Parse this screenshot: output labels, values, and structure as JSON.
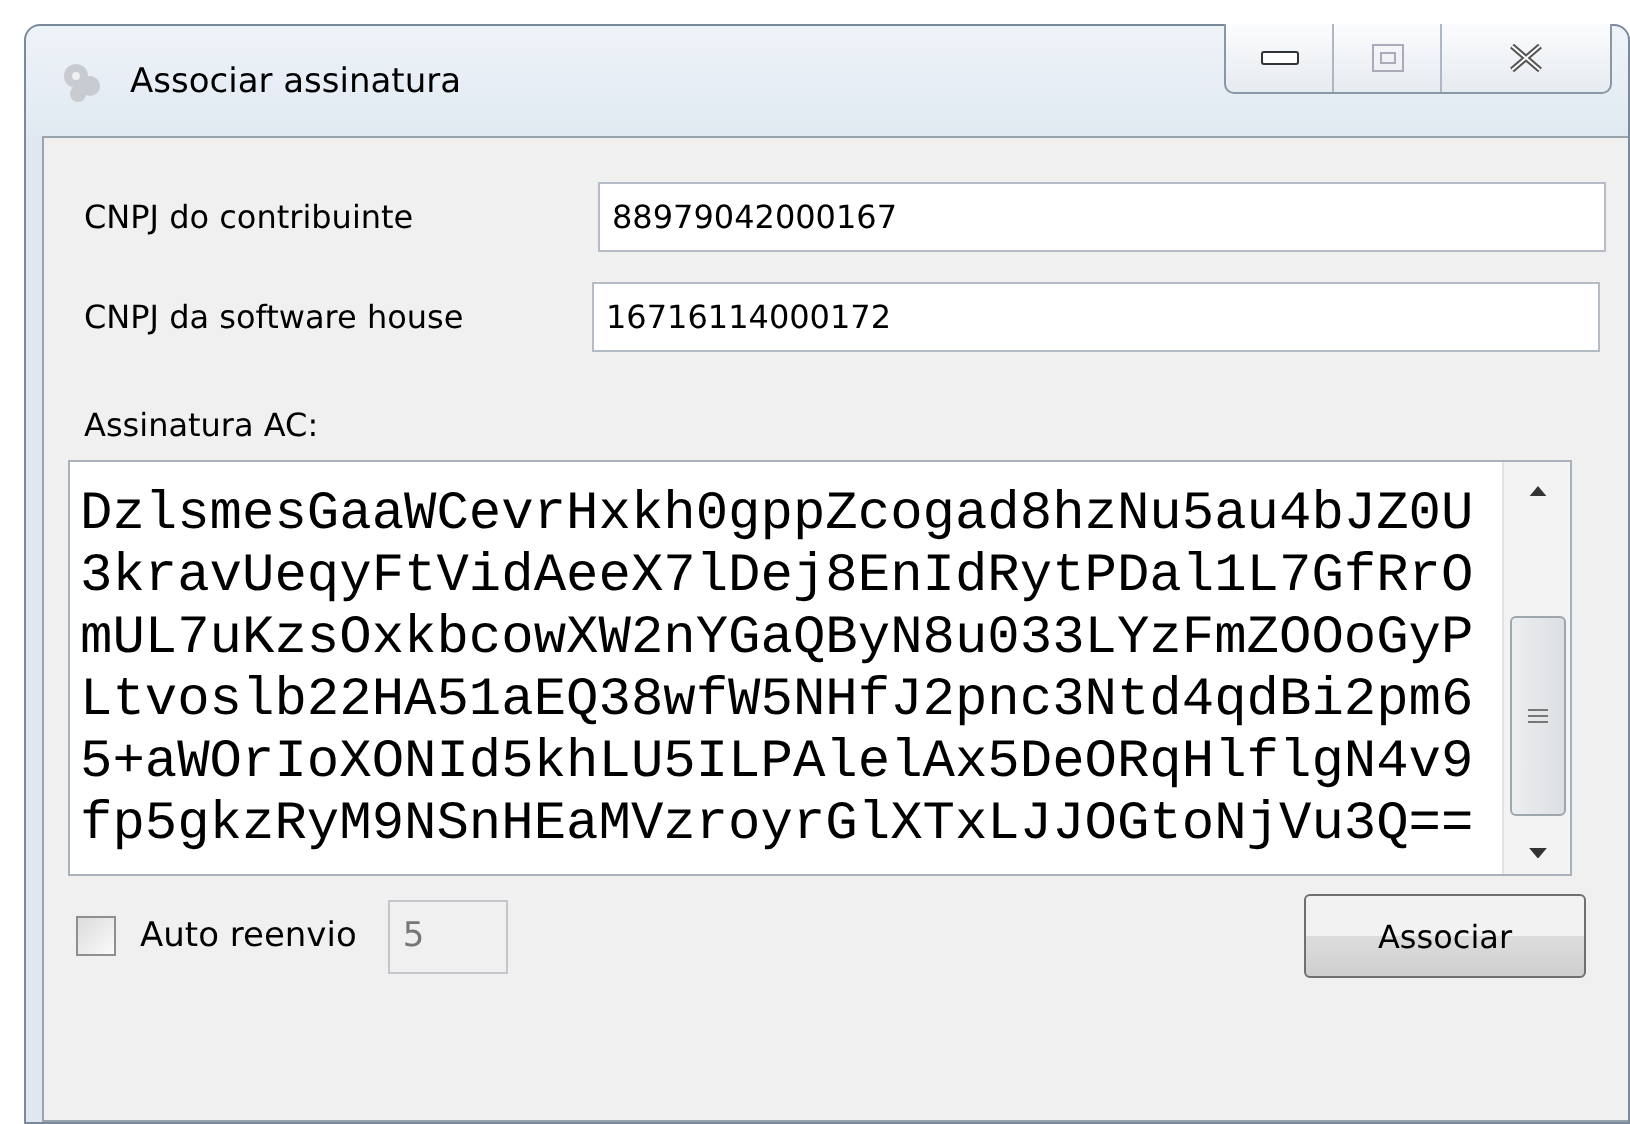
{
  "window": {
    "title": "Associar assinatura"
  },
  "fields": [
    {
      "label": "CNPJ do contribuinte",
      "value": "88979042000167"
    },
    {
      "label": "CNPJ da software house",
      "value": "16716114000172"
    }
  ],
  "signature": {
    "label": "Assinatura AC:",
    "lines": [
      "DzlsmesGaaWCevrHxkh0gppZcogad8hzNu5au4bJZ0U",
      "3kravUeqyFtVidAeeX7lDej8EnIdRytPDal1L7GfRrO",
      "mUL7uKzsOxkbcowXW2nYGaQByN8u033LYzFmZOOoGyP",
      "Ltvoslb22HA51aEQ38wfW5NHfJ2pnc3Ntd4qdBi2pm6",
      "5+aWOrIoXONId5khLU5ILPAlelAx5DeORqHlflgN4v9",
      "fp5gkzRyM9NSnHEaMVzroyrGlXTxLJJOGtoNjVu3Q=="
    ]
  },
  "auto_resend": {
    "label": "Auto reenvio",
    "checked": false,
    "value": "5"
  },
  "buttons": [
    {
      "label": "Associar"
    }
  ]
}
